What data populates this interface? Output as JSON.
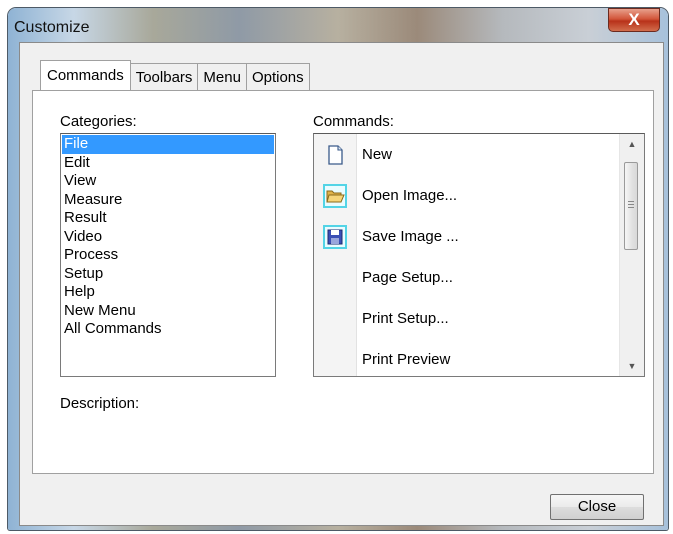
{
  "window": {
    "title": "Customize",
    "close_glyph": "X"
  },
  "tabs": [
    {
      "label": "Commands",
      "active": true
    },
    {
      "label": "Toolbars",
      "active": false
    },
    {
      "label": "Menu",
      "active": false
    },
    {
      "label": "Options",
      "active": false
    }
  ],
  "categories": {
    "label": "Categories:",
    "selected": "File",
    "items": [
      "File",
      "Edit",
      "View",
      "Measure",
      "Result",
      "Video",
      "Process",
      "Setup",
      "Help",
      "New Menu",
      "All Commands"
    ]
  },
  "commands": {
    "label": "Commands:",
    "items": [
      {
        "label": "New",
        "icon": "new-document-icon"
      },
      {
        "label": "Open Image...",
        "icon": "open-folder-icon"
      },
      {
        "label": "Save Image ...",
        "icon": "save-floppy-icon"
      },
      {
        "label": "Page Setup...",
        "icon": ""
      },
      {
        "label": "Print Setup...",
        "icon": ""
      },
      {
        "label": "Print Preview",
        "icon": ""
      }
    ]
  },
  "description": {
    "label": "Description:"
  },
  "buttons": {
    "close_label": "Close"
  },
  "colors": {
    "selection": "#3399ff",
    "icon_frame": "#53d4e6"
  }
}
